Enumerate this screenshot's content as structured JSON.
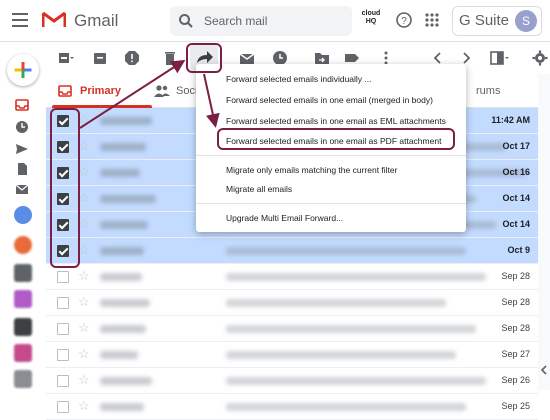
{
  "header": {
    "app_name": "Gmail",
    "search_placeholder": "Search mail",
    "cloudhq_label": "cloud HQ",
    "gsuite_label": "G Suite",
    "avatar_initial": "S"
  },
  "tabs": {
    "primary": "Primary",
    "social": "Soci",
    "forums": "rums"
  },
  "menu": {
    "items": [
      "Forward selected emails individually ...",
      "Forward selected emails in one email (merged in body)",
      "Forward selected emails in one email as EML attachments",
      "Forward selected emails in one email as PDF attachment",
      "Migrate only emails matching the current filter",
      "Migrate all emails",
      "Upgrade Multi Email Forward..."
    ]
  },
  "emails": [
    {
      "selected": true,
      "date": "11:42 AM"
    },
    {
      "selected": true,
      "date": "Oct 17"
    },
    {
      "selected": true,
      "date": "Oct 16"
    },
    {
      "selected": true,
      "date": "Oct 14"
    },
    {
      "selected": true,
      "date": "Oct 14"
    },
    {
      "selected": true,
      "date": "Oct 9"
    },
    {
      "selected": false,
      "date": "Sep 28"
    },
    {
      "selected": false,
      "date": "Sep 28"
    },
    {
      "selected": false,
      "date": "Sep 28"
    },
    {
      "selected": false,
      "date": "Sep 27"
    },
    {
      "selected": false,
      "date": "Sep 26"
    },
    {
      "selected": false,
      "date": "Sep 25"
    }
  ],
  "colors": {
    "accent_red": "#d93025",
    "selected_row": "#c2dbff",
    "highlight": "#7b1f45"
  }
}
